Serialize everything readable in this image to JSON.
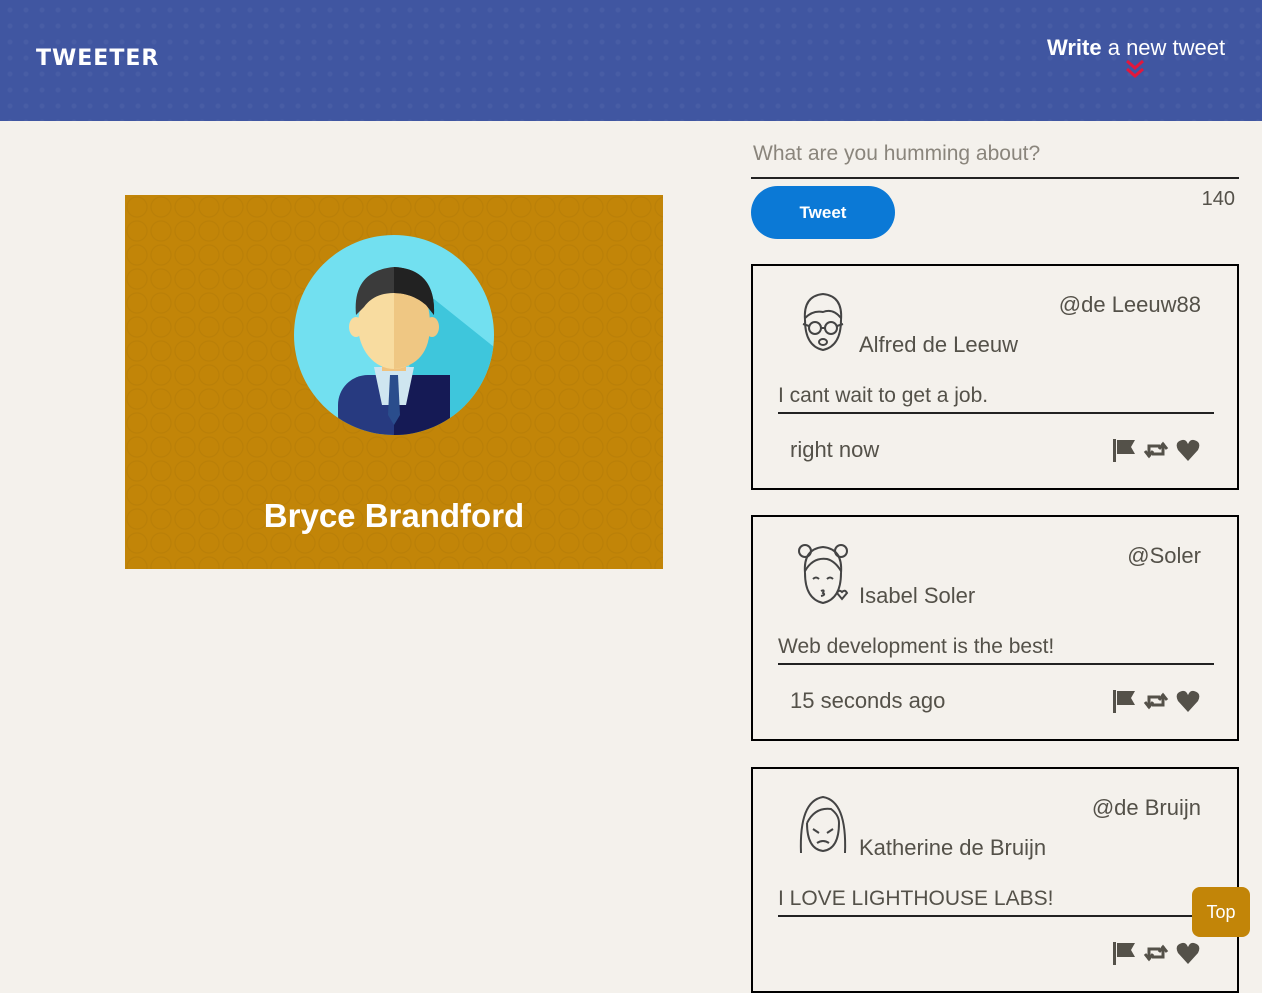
{
  "nav": {
    "brand": "TWEETER",
    "compose_bold": "Write",
    "compose_rest": " a new tweet",
    "toggle_icon": "double-chevron-down-icon",
    "accent_color": "#e3173c"
  },
  "profile": {
    "name": "Bryce Brandford",
    "avatar_icon": "businessman-avatar-icon",
    "card_color": "#c28508"
  },
  "compose": {
    "placeholder": "What are you humming about?",
    "button_label": "Tweet",
    "counter": "140"
  },
  "tweets": [
    {
      "name": "Alfred de Leeuw",
      "handle": "@de Leeuw88",
      "content": "I cant wait to get a job.",
      "time": "right now",
      "avatar_icon": "man-glasses-avatar-icon"
    },
    {
      "name": "Isabel Soler",
      "handle": "@Soler",
      "content": "Web development is the best!",
      "time": "15 seconds ago",
      "avatar_icon": "girl-kiss-avatar-icon"
    },
    {
      "name": "Katherine de Bruijn",
      "handle": "@de Bruijn",
      "content": "I LOVE LIGHTHOUSE LABS!",
      "time": "",
      "avatar_icon": "woman-avatar-icon"
    }
  ],
  "action_icons": [
    "flag-icon",
    "retweet-icon",
    "heart-icon"
  ],
  "scroll_top": {
    "label": "Top"
  }
}
